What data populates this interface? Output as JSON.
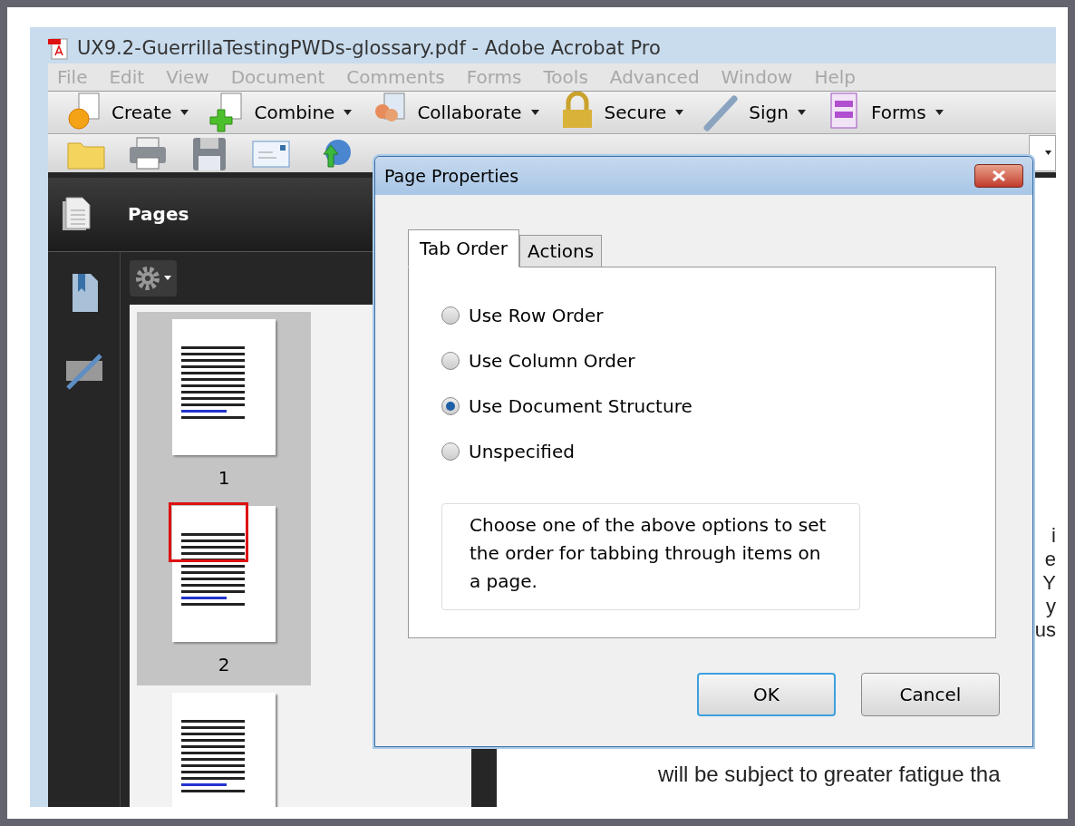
{
  "window": {
    "title": "UX9.2-GuerrillaTestingPWDs-glossary.pdf - Adobe Acrobat Pro"
  },
  "menu": [
    {
      "label": "File",
      "disabled": true
    },
    {
      "label": "Edit",
      "disabled": true
    },
    {
      "label": "View",
      "disabled": true
    },
    {
      "label": "Document",
      "disabled": true
    },
    {
      "label": "Comments",
      "disabled": true
    },
    {
      "label": "Forms",
      "disabled": true
    },
    {
      "label": "Tools",
      "disabled": true
    },
    {
      "label": "Advanced",
      "disabled": true
    },
    {
      "label": "Window",
      "disabled": true
    },
    {
      "label": "Help",
      "disabled": true
    }
  ],
  "task_toolbar": [
    {
      "label": "Create",
      "kind": "create"
    },
    {
      "label": "Combine",
      "kind": "combine"
    },
    {
      "label": "Collaborate",
      "kind": "collaborate"
    },
    {
      "label": "Secure",
      "kind": "secure"
    },
    {
      "label": "Sign",
      "kind": "sign"
    },
    {
      "label": "Forms",
      "kind": "forms"
    }
  ],
  "file_toolbar": [
    {
      "kind": "open"
    },
    {
      "kind": "print"
    },
    {
      "kind": "save"
    },
    {
      "kind": "email"
    },
    {
      "kind": "upload"
    }
  ],
  "pages_panel": {
    "title": "Pages",
    "thumbnails": [
      {
        "label": "1",
        "current": false
      },
      {
        "label": "2",
        "current": true
      },
      {
        "current": false
      }
    ]
  },
  "document": {
    "fragments": [
      "i",
      "e",
      "Y",
      "y",
      "us"
    ],
    "last_line": "will be subject to greater fatigue tha"
  },
  "dialog": {
    "title": "Page Properties",
    "tabs": [
      {
        "label": "Tab Order",
        "selected": true
      },
      {
        "label": "Actions",
        "selected": false
      }
    ],
    "options": [
      {
        "label": "Use Row Order",
        "selected": false
      },
      {
        "label": "Use Column Order",
        "selected": false
      },
      {
        "label": "Use Document Structure",
        "selected": true
      },
      {
        "label": "Unspecified",
        "selected": false
      }
    ],
    "description": "Choose one of the above options to set the order for tabbing through items on a page.",
    "buttons": [
      {
        "label": "OK",
        "kind": "default"
      },
      {
        "label": "Cancel",
        "kind": "normal"
      }
    ]
  }
}
